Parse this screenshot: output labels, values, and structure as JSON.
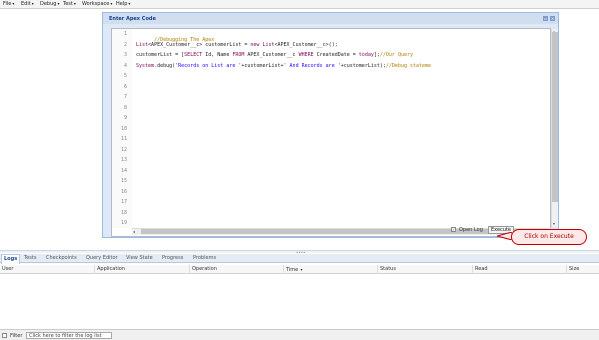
{
  "menu": [
    {
      "label": "File"
    },
    {
      "label": "Edit"
    },
    {
      "label": "Debug"
    },
    {
      "label": "Test"
    },
    {
      "label": "Workspace"
    },
    {
      "label": "Help"
    }
  ],
  "modal": {
    "title": "Enter Apex Code",
    "line_numbers": [
      "1",
      "2",
      "3",
      "4",
      "5",
      "6",
      "7",
      "8",
      "9",
      "10",
      "11",
      "12",
      "13",
      "14",
      "15",
      "16",
      "17",
      "18",
      "19"
    ],
    "code": {
      "line1": "//Debugging The Apex",
      "line2": {
        "t1": "List",
        "t2": "<APEX_Customer__c> customerList = ",
        "t3": "new",
        "t4": " List",
        "t5": "<APEX_Customer__c>();"
      },
      "line3": {
        "t1": "customerList = [",
        "t2": "SELECT",
        "t3": " Id, Name ",
        "t4": "FROM",
        "t5": " APEX_Customer__c ",
        "t6": "WHERE",
        "t7": " CreatedDate = ",
        "t8": "today",
        "t9": "];",
        "t10": "//Our Query"
      },
      "line4": {
        "t1": "System",
        "t2": ".debug(",
        "t3": "'Records on List are '",
        "t4": "+customerList+",
        "t5": "' And Records are '",
        "t6": "+customerList);",
        "t7": "//Debug stateme"
      }
    },
    "open_log_label": "Open Log",
    "open_log_checked": true,
    "execute_label": "Execute"
  },
  "callout": {
    "text": "Click on Execute",
    "color": "#c00000"
  },
  "tabs": [
    {
      "label": "Logs",
      "active": true
    },
    {
      "label": "Tests"
    },
    {
      "label": "Checkpoints"
    },
    {
      "label": "Query Editor"
    },
    {
      "label": "View State"
    },
    {
      "label": "Progress"
    },
    {
      "label": "Problems"
    }
  ],
  "columns": [
    "User",
    "Application",
    "Operation",
    "Time",
    "Status",
    "Read",
    "Size"
  ],
  "filter": {
    "label": "Filter",
    "placeholder": "Click here to filter the log list"
  },
  "colors": {
    "accent": "#15428b",
    "modal_border": "#99bbe8",
    "comment": "#b07d00",
    "keyword": "#7f0055",
    "string": "#2a00ff"
  }
}
